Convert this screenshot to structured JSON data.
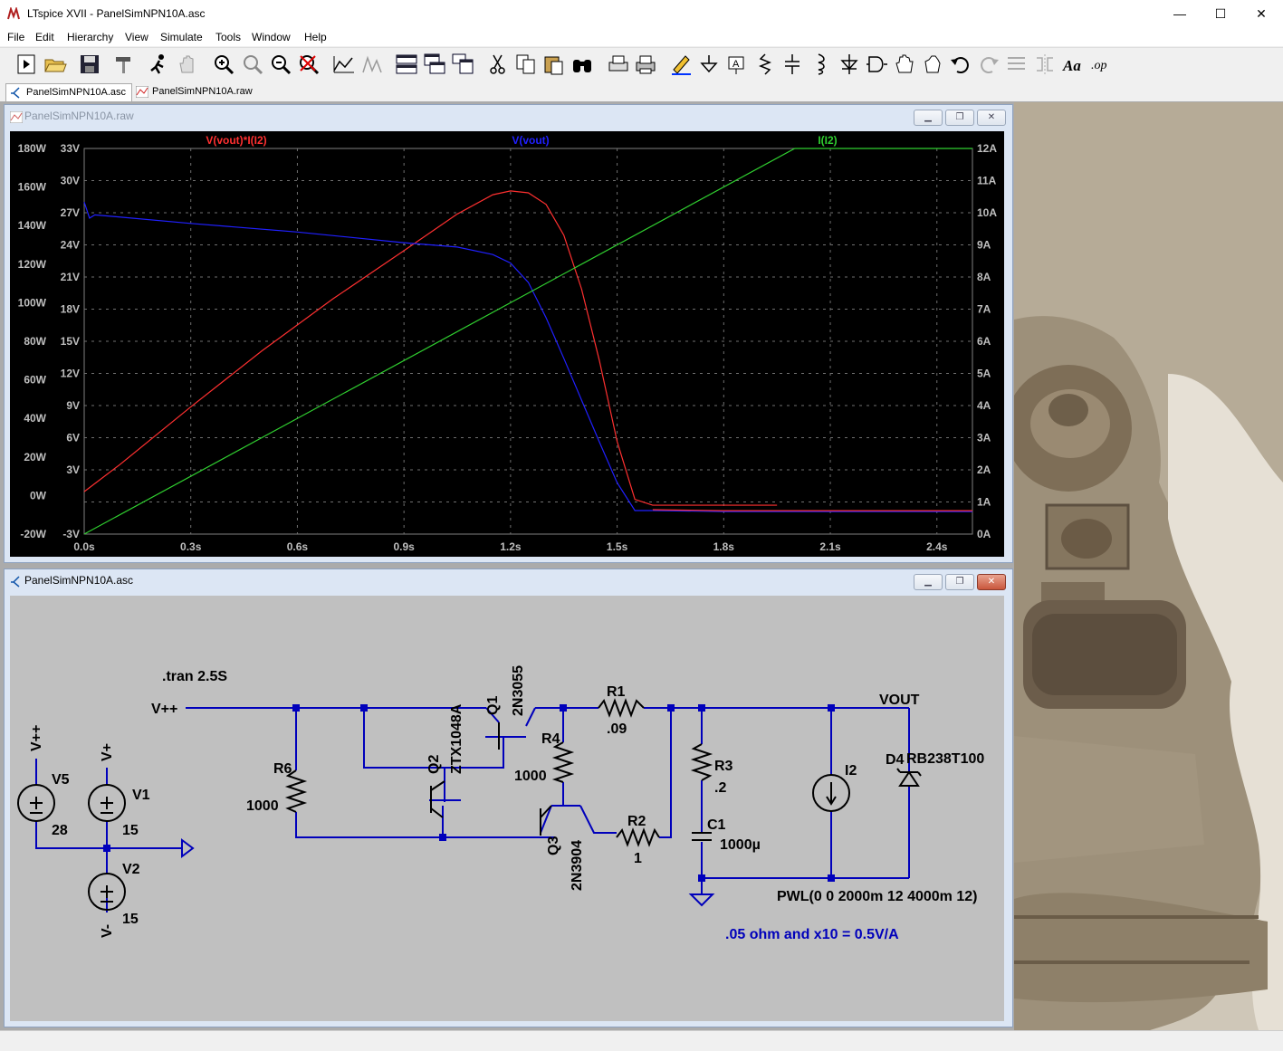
{
  "window": {
    "title": "LTspice XVII - PanelSimNPN10A.asc"
  },
  "menu": [
    "File",
    "Edit",
    "Hierarchy",
    "View",
    "Simulate",
    "Tools",
    "Window",
    "Help"
  ],
  "tabs": [
    {
      "label": "PanelSimNPN10A.asc",
      "active": true
    },
    {
      "label": "PanelSimNPN10A.raw",
      "active": false
    }
  ],
  "plot_window": {
    "title": "PanelSimNPN10A.raw"
  },
  "schematic_window": {
    "title": "PanelSimNPN10A.asc"
  },
  "chart_data": {
    "type": "line",
    "background": "#000000",
    "grid": true,
    "x_ticks": [
      "0.0s",
      "0.3s",
      "0.6s",
      "0.9s",
      "1.2s",
      "1.5s",
      "1.8s",
      "2.1s",
      "2.4s"
    ],
    "xlim": [
      0,
      2.5
    ],
    "left_axis_power_ticks": [
      "180W",
      "160W",
      "140W",
      "120W",
      "100W",
      "80W",
      "60W",
      "40W",
      "20W",
      "0W",
      "-20W"
    ],
    "power_range": [
      -20,
      180
    ],
    "left_axis_voltage_ticks": [
      "33V",
      "30V",
      "27V",
      "24V",
      "21V",
      "18V",
      "15V",
      "12V",
      "9V",
      "6V",
      "3V",
      "-3V"
    ],
    "voltage_range": [
      -3,
      33
    ],
    "right_axis_current_ticks": [
      "12A",
      "11A",
      "10A",
      "9A",
      "8A",
      "7A",
      "6A",
      "5A",
      "4A",
      "3A",
      "2A",
      "1A",
      "0A"
    ],
    "current_range": [
      0,
      12
    ],
    "series": [
      {
        "name": "V(vout)*I(I2)",
        "color": "#ff3030",
        "axis": "power",
        "x": [
          0,
          0.1,
          0.3,
          0.5,
          0.7,
          0.9,
          1.05,
          1.15,
          1.2,
          1.25,
          1.3,
          1.35,
          1.4,
          1.45,
          1.5,
          1.55,
          1.6,
          1.7,
          1.8,
          1.9,
          1.95
        ],
        "y": [
          2,
          16,
          46,
          75,
          102,
          127,
          146,
          156,
          158,
          157,
          151,
          135,
          107,
          70,
          28,
          -2,
          -5,
          -5,
          -5,
          -5,
          -5
        ]
      },
      {
        "name": "V(vout)",
        "color": "#2020ff",
        "axis": "voltage",
        "x": [
          0,
          0.015,
          0.03,
          0.1,
          0.3,
          0.6,
          0.9,
          1.05,
          1.15,
          1.2,
          1.25,
          1.3,
          1.35,
          1.4,
          1.45,
          1.5,
          1.55,
          1.6,
          1.8,
          2.1,
          2.5
        ],
        "y": [
          28,
          26.5,
          26.8,
          26.6,
          26,
          25.2,
          24.2,
          23.8,
          23.1,
          22.3,
          20.5,
          17.2,
          13.4,
          9.5,
          5.6,
          1.8,
          -0.8,
          -0.8,
          -0.9,
          -0.9,
          -0.9
        ],
        "color_after_x": 1.6,
        "color_after": "#ff3030"
      },
      {
        "name": "I(I2)",
        "color": "#30d030",
        "axis": "current",
        "x": [
          0,
          2,
          2.5
        ],
        "y": [
          0,
          12,
          12
        ]
      }
    ]
  },
  "schematic": {
    "directive": ".tran 2.5S",
    "net_vpp": "V++",
    "net_vout": "VOUT",
    "components": [
      {
        "ref": "V5",
        "value": "28",
        "net": "V++"
      },
      {
        "ref": "V1",
        "value": "15",
        "net": "V+"
      },
      {
        "ref": "V2",
        "value": "15",
        "net": "V-"
      },
      {
        "ref": "R6",
        "value": "1000"
      },
      {
        "ref": "Q2",
        "value": "ZTX1048A"
      },
      {
        "ref": "Q1",
        "value": "2N3055"
      },
      {
        "ref": "R4",
        "value": "1000"
      },
      {
        "ref": "Q3",
        "value": "2N3904"
      },
      {
        "ref": "R1",
        "value": ".09"
      },
      {
        "ref": "R2",
        "value": "1"
      },
      {
        "ref": "R3",
        "value": ".2"
      },
      {
        "ref": "C1",
        "value": "1000µ"
      },
      {
        "ref": "I2",
        "value": "PWL(0 0 2000m 12 4000m 12)"
      },
      {
        "ref": "D4",
        "value": "RB238T100"
      }
    ],
    "comment": ".05 ohm and x10 = 0.5V/A"
  }
}
